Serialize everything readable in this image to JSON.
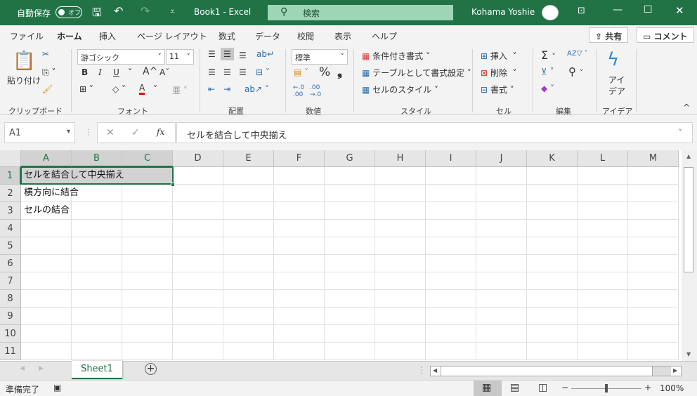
{
  "titlebar": {
    "autosave": "自動保存",
    "autosave_state": "オフ",
    "doc_title": "Book1  -  Excel",
    "search": "検索",
    "user": "Kohama Yoshie"
  },
  "tabs": [
    "ファイル",
    "ホーム",
    "挿入",
    "ページ レイアウト",
    "数式",
    "データ",
    "校閲",
    "表示",
    "ヘルプ"
  ],
  "active_tab": "ホーム",
  "share": "共有",
  "comment": "コメント",
  "ribbon": {
    "clipboard": {
      "paste": "貼り付け",
      "label": "クリップボード"
    },
    "font": {
      "name": "游ゴシック",
      "size": "11",
      "bold": "B",
      "italic": "I",
      "underline": "U",
      "grow": "A^",
      "shrink": "Aˇ",
      "color": "A",
      "label": "フォント"
    },
    "align": {
      "label": "配置"
    },
    "number": {
      "format": "標準",
      "percent": "%",
      "comma": "❟",
      "inc": "←.0 .00",
      "dec": ".00 →.0",
      "label": "数値"
    },
    "styles": {
      "cond": "条件付き書式",
      "table": "テーブルとして書式設定",
      "cell": "セルのスタイル",
      "label": "スタイル"
    },
    "cells": {
      "insert": "挿入",
      "delete": "削除",
      "format": "書式",
      "label": "セル"
    },
    "edit": {
      "sum": "Σ",
      "sort": "AZ▽",
      "find": "⚲",
      "label": "編集"
    },
    "ideas": {
      "btn": "アイ デア",
      "label": "アイデア"
    }
  },
  "formula_bar": {
    "name_box": "A1",
    "cancel": "✕",
    "enter": "✓",
    "fx": "fx",
    "content": "セルを結合して中央揃え"
  },
  "columns": [
    "A",
    "B",
    "C",
    "D",
    "E",
    "F",
    "G",
    "H",
    "I",
    "J",
    "K",
    "L",
    "M"
  ],
  "rows": [
    "1",
    "2",
    "3",
    "4",
    "5",
    "6",
    "7",
    "8",
    "9",
    "10",
    "11"
  ],
  "cells": {
    "A1": "セルを結合して中央揃え",
    "A2": "横方向に結合",
    "A3": "セルの結合"
  },
  "sheet": {
    "tab": "Sheet1",
    "add": "+"
  },
  "status": {
    "ready": "準備完了",
    "zoom": "100%",
    "minus": "−",
    "plus": "+"
  }
}
